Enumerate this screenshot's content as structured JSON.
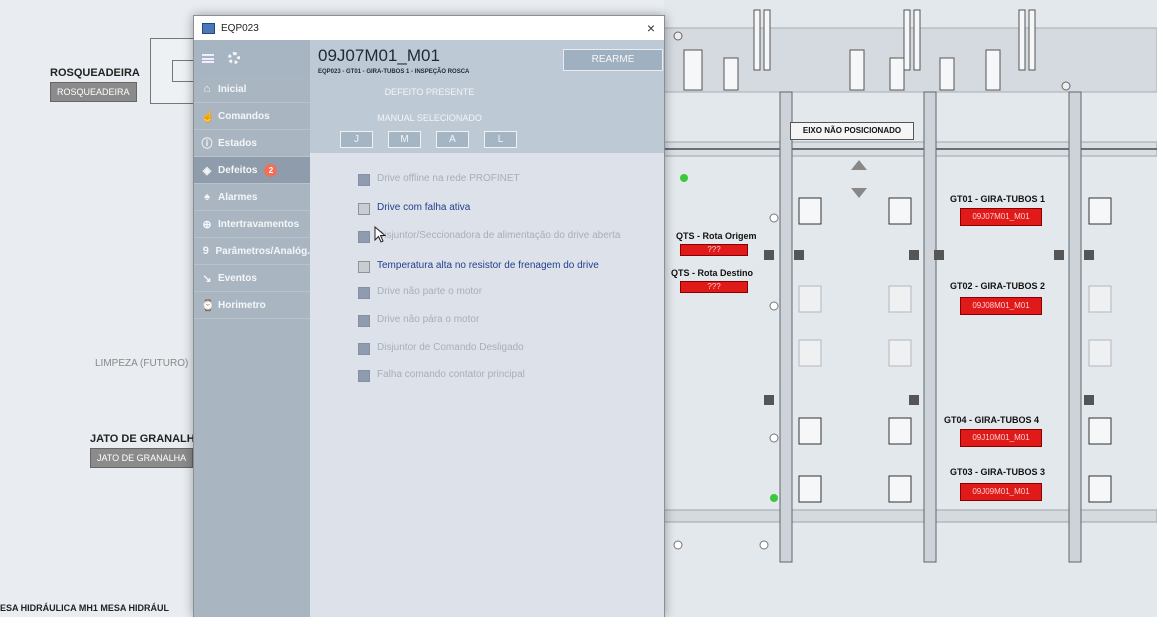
{
  "background": {
    "rosqueadeira_label": "ROSQUEADEIRA",
    "rosqueadeira_badge": "ROSQUEADEIRA",
    "limpeza_label": "LIMPEZA (FUTURO)",
    "jato_label": "JATO DE GRANALHA",
    "jato_badge": "JATO DE GRANALHA",
    "bottom_text": "ESA HIDRÁULICA MH1    MESA HIDRÁUL",
    "eixo_label": "EIXO NÃO POSICIONADO",
    "qts_origem_label": "QTS - Rota Origem",
    "qts_origem_value": "???",
    "qts_destino_label": "QTS - Rota Destino",
    "qts_destino_value": "???",
    "gt01_title": "GT01 - GIRA-TUBOS 1",
    "gt01_tag": "09J07M01_M01",
    "gt02_title": "GT02 - GIRA-TUBOS 2",
    "gt02_tag": "09J08M01_M01",
    "gt04_title": "GT04 - GIRA-TUBOS 4",
    "gt04_tag": "09J10M01_M01",
    "gt03_title": "GT03 - GIRA-TUBOS 3",
    "gt03_tag": "09J09M01_M01",
    "colors": {
      "alarm_red": "#e01919",
      "active_fault": "#24408c",
      "inactive_fault": "#a6afba",
      "sidebar": "#a9b6c2"
    }
  },
  "dialog": {
    "window_title": "EQP023",
    "close_glyph": "×",
    "device_id": "09J07M01_M01",
    "device_path": "EQP023 - GT01 - GIRA-TUBOS 1 - INSPEÇÃO ROSCA",
    "rearme_label": "REARME",
    "status_fault": "DEFEITO PRESENTE",
    "status_mode": "MANUAL SELECIONADO",
    "modes": [
      "J",
      "M",
      "A",
      "L"
    ],
    "nav": [
      {
        "label": "Inicial",
        "icon": "home-icon",
        "glyph": "⌂"
      },
      {
        "label": "Comandos",
        "icon": "hand-icon",
        "glyph": "☝"
      },
      {
        "label": "Estados",
        "icon": "info-icon",
        "glyph": "ⓘ"
      },
      {
        "label": "Defeitos",
        "icon": "fault-icon",
        "glyph": "◈",
        "badge": "2"
      },
      {
        "label": "Alarmes",
        "icon": "bell-icon",
        "glyph": "♠"
      },
      {
        "label": "Intertravamentos",
        "icon": "interlock-icon",
        "glyph": "⊕"
      },
      {
        "label": "Parâmetros/Analóg.",
        "icon": "parameters-icon",
        "glyph": "9"
      },
      {
        "label": "Eventos",
        "icon": "events-icon",
        "glyph": "↘"
      },
      {
        "label": "Horimetro",
        "icon": "clock-icon",
        "glyph": "⌚"
      }
    ],
    "faults": [
      {
        "label": "Drive offline na rede PROFINET",
        "active": false
      },
      {
        "label": "Drive com falha ativa",
        "active": true
      },
      {
        "label": "Disjuntor/Seccionadora de alimentação do drive aberta",
        "active": false
      },
      {
        "label": "Temperatura alta no resistor de frenagem do drive",
        "active": true
      },
      {
        "label": "Drive não parte o motor",
        "active": false
      },
      {
        "label": "Drive não pára o motor",
        "active": false
      },
      {
        "label": "Disjuntor de Comando Desligado",
        "active": false
      },
      {
        "label": "Falha comando contator principal",
        "active": false
      }
    ]
  }
}
